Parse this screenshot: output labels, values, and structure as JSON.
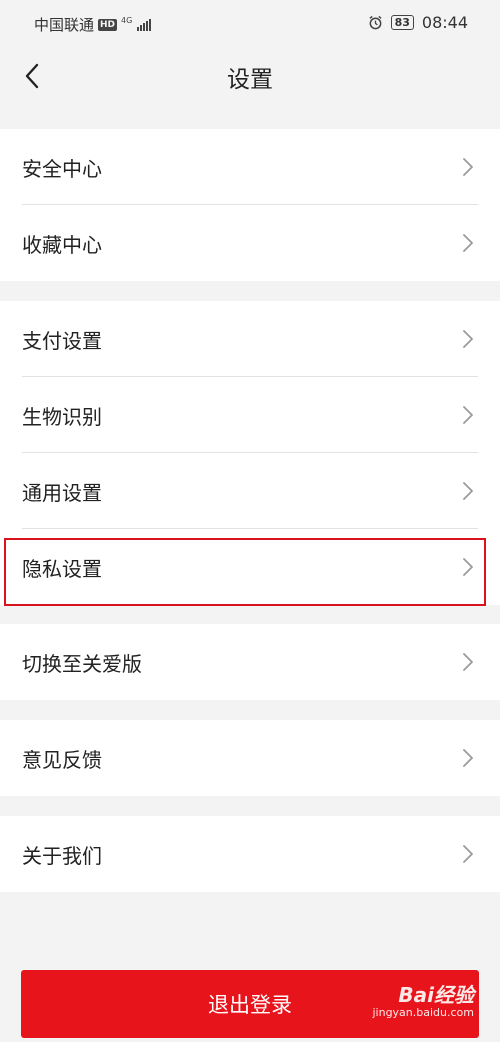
{
  "status_bar": {
    "carrier": "中国联通",
    "hd_badge": "HD",
    "network": "4G",
    "battery": "83",
    "time": "08:44",
    "alarm_icon": "alarm-clock-icon",
    "signal_icon": "signal-bars-icon"
  },
  "nav": {
    "title": "设置",
    "back_icon": "chevron-left-icon"
  },
  "groups": [
    {
      "items": [
        {
          "label": "安全中心"
        },
        {
          "label": "收藏中心"
        }
      ]
    },
    {
      "items": [
        {
          "label": "支付设置"
        },
        {
          "label": "生物识别"
        },
        {
          "label": "通用设置"
        },
        {
          "label": "隐私设置",
          "highlighted": true
        }
      ]
    },
    {
      "items": [
        {
          "label": "切换至关爱版"
        }
      ]
    },
    {
      "items": [
        {
          "label": "意见反馈"
        }
      ]
    },
    {
      "items": [
        {
          "label": "关于我们"
        }
      ]
    }
  ],
  "logout": {
    "label": "退出登录"
  },
  "watermark": {
    "main": "Bai经验",
    "sub": "jingyan.baidu.com"
  },
  "colors": {
    "background": "#f3f3f3",
    "accent_red": "#e8141b",
    "highlight_border": "#d8131c",
    "chevron": "#9a9a9a"
  }
}
